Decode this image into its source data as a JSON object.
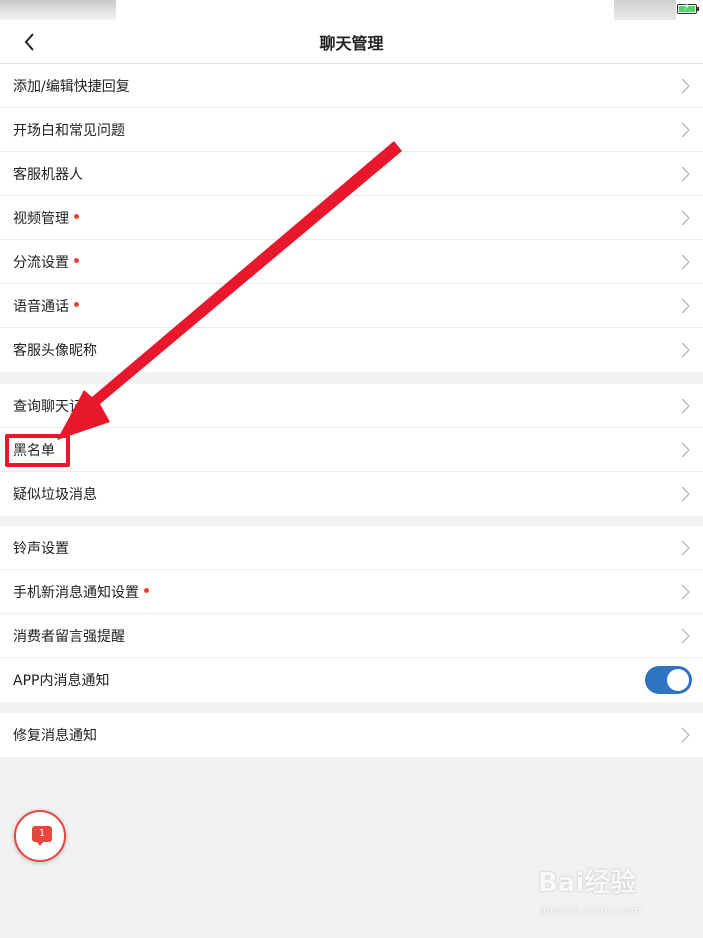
{
  "nav": {
    "title": "聊天管理"
  },
  "groups": [
    {
      "items": [
        {
          "label": "添加/编辑快捷回复"
        },
        {
          "label": "开场白和常见问题"
        },
        {
          "label": "客服机器人"
        },
        {
          "label": "视频管理"
        },
        {
          "label": "分流设置"
        },
        {
          "label": "语音通话"
        },
        {
          "label": "客服头像昵称"
        }
      ]
    },
    {
      "items": [
        {
          "label": "查询聊天记"
        },
        {
          "label": "黑名单"
        },
        {
          "label": "疑似垃圾消息"
        }
      ]
    },
    {
      "items": [
        {
          "label": "铃声设置"
        },
        {
          "label": "手机新消息通知设置"
        },
        {
          "label": "消费者留言强提醒"
        },
        {
          "label": "APP内消息通知",
          "toggle_on": true
        }
      ]
    },
    {
      "items": [
        {
          "label": "修复消息通知"
        }
      ]
    }
  ],
  "floating_chat": {
    "badge_count": "1"
  },
  "watermark": {
    "brand": "Bai经验",
    "url": "jingyan.baidu.com"
  },
  "colors": {
    "accent_red": "#e8172c",
    "toggle_blue": "#2f74c0",
    "dot_red": "#ff3b30"
  }
}
